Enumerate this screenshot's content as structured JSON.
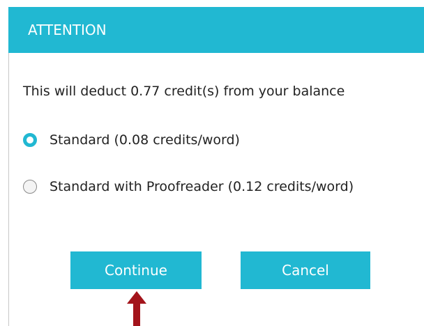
{
  "dialog": {
    "title": "ATTENTION",
    "message": "This will deduct 0.77 credit(s) from your balance",
    "options": [
      {
        "label": "Standard (0.08 credits/word)",
        "selected": true
      },
      {
        "label": "Standard with Proofreader (0.12 credits/word)",
        "selected": false
      }
    ],
    "buttons": {
      "continue_label": "Continue",
      "cancel_label": "Cancel"
    }
  },
  "colors": {
    "accent": "#21b8d2",
    "arrow": "#a3141b"
  },
  "annotation": {
    "icon": "up-arrow-icon"
  }
}
